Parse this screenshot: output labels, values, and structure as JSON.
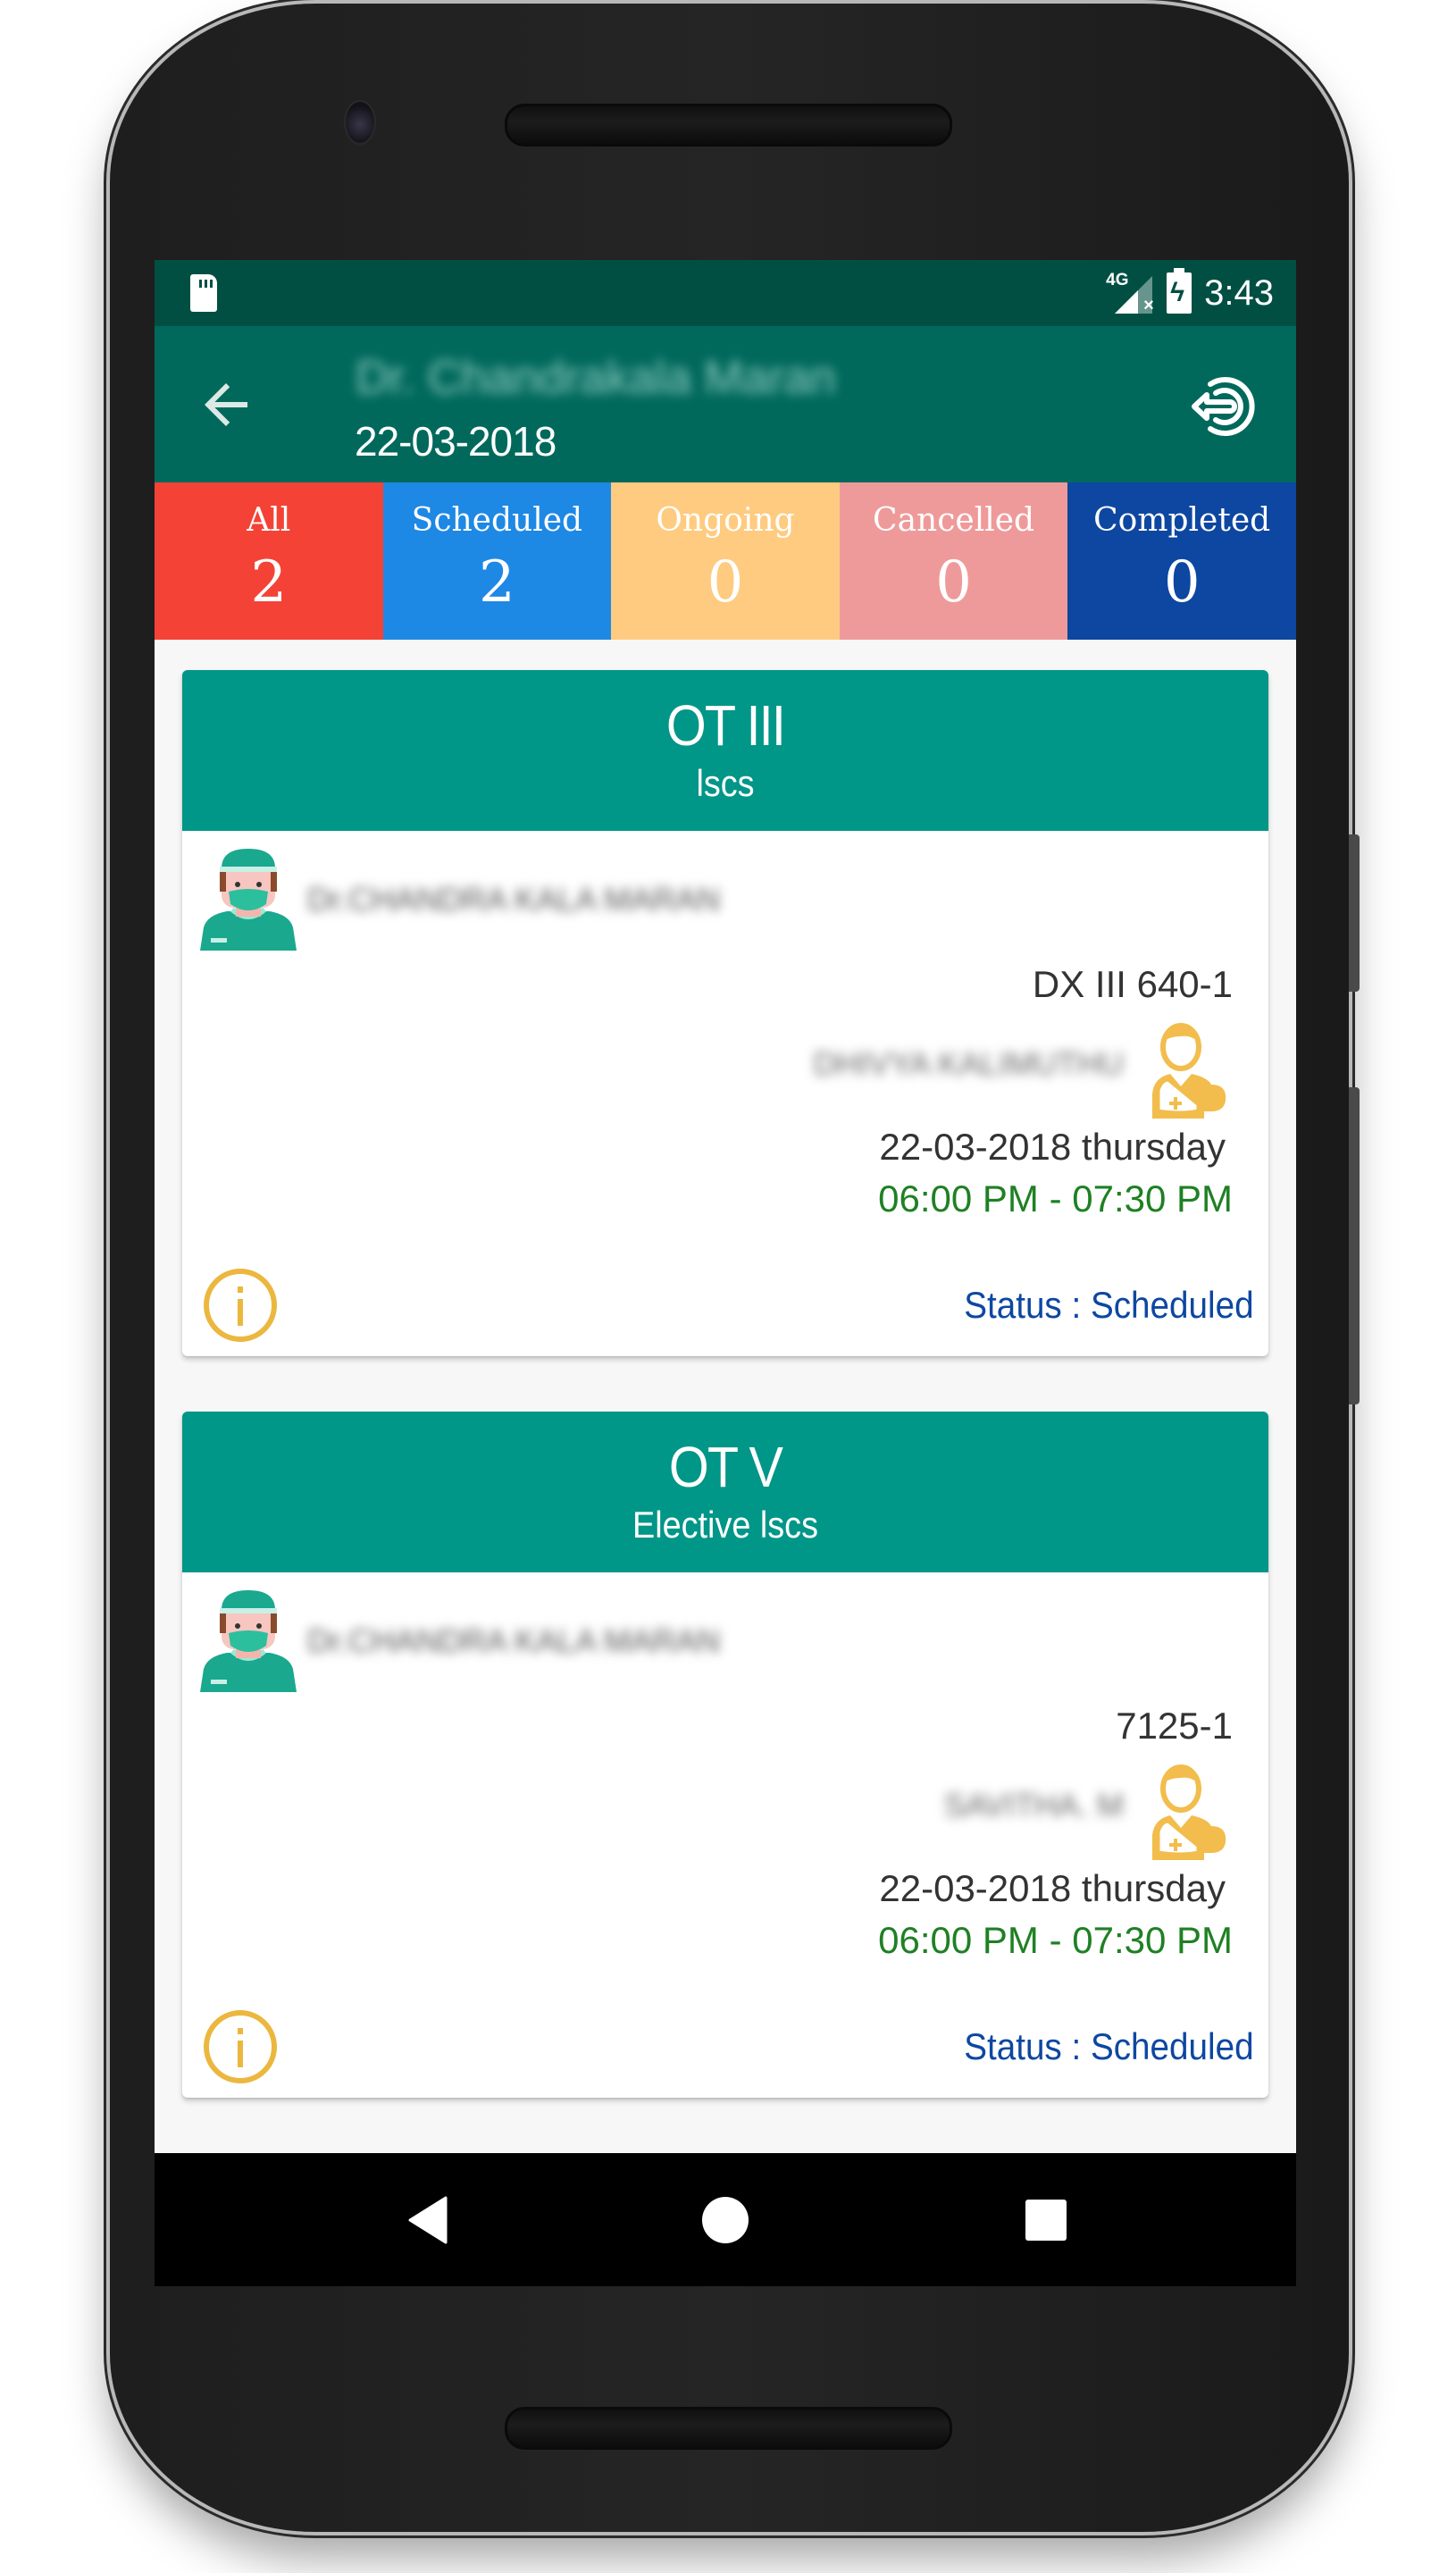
{
  "status_bar": {
    "network": "4G",
    "time": "3:43"
  },
  "app_bar": {
    "title": "Dr. Chandrakala Maran",
    "date": "22-03-2018"
  },
  "tabs": [
    {
      "label": "All",
      "count": "2",
      "color": "#f44336"
    },
    {
      "label": "Scheduled",
      "count": "2",
      "color": "#1e88e5"
    },
    {
      "label": "Ongoing",
      "count": "0",
      "color": "#fecb80"
    },
    {
      "label": "Cancelled",
      "count": "0",
      "color": "#ef9a9a"
    },
    {
      "label": "Completed",
      "count": "0",
      "color": "#0d47a1"
    }
  ],
  "cards": [
    {
      "theatre": "OT III",
      "procedure": "lscs",
      "doctor_name": "Dr.CHANDRA KALA MARAN",
      "case_no": "DX III 640-1",
      "patient_name": "DHIVYA KALIMUTHU",
      "date": "22-03-2018 thursday",
      "time": "06:00 PM - 07:30 PM",
      "status": "Status : Scheduled"
    },
    {
      "theatre": "OT V",
      "procedure": "Elective lscs",
      "doctor_name": "Dr.CHANDRA KALA MARAN",
      "case_no": "7125-1",
      "patient_name": "SAVITHA. M",
      "date": "22-03-2018 thursday",
      "time": "06:00 PM - 07:30 PM",
      "status": "Status : Scheduled"
    }
  ],
  "colors": {
    "status_bar": "#014f43",
    "app_bar": "#00695c",
    "card_header": "#009688",
    "time": "#1f8024",
    "status": "#0d47a1",
    "accent_icon": "#f0bb4a"
  }
}
